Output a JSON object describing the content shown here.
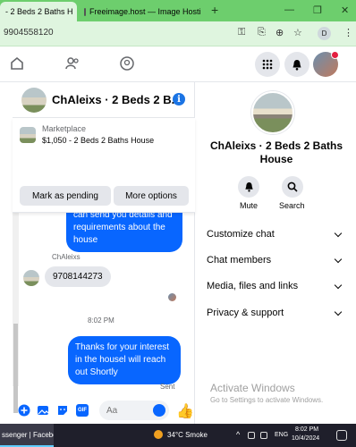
{
  "browser": {
    "tabs": [
      {
        "title": "- 2 Beds 2 Baths H",
        "active": true
      },
      {
        "title": "Freeimage.host — Image Hosti",
        "active": false
      }
    ],
    "new_tab": "+",
    "url": "9904558120",
    "profile_initial": "D"
  },
  "chat": {
    "title": "ChAleixs · 2 Beds 2 B...",
    "marketplace": {
      "label": "Marketplace",
      "listing": "$1,050 - 2 Beds 2 Baths House",
      "mark_pending": "Mark as pending",
      "more_options": "More options"
    },
    "messages": {
      "outgoing_1": "Yes the house is still available for rent,let me your contact number so i can send you details and requirements about the house",
      "sender_name": "ChAleixs",
      "incoming_1": "9708144273",
      "timestamp": "8:02 PM",
      "outgoing_2": "Thanks for your interest in the housel will reach out Shortly",
      "sent_status": "Sent"
    },
    "composer": {
      "placeholder": "Aa"
    }
  },
  "info_panel": {
    "name": "ChAleixs · 2 Beds 2 Baths House",
    "actions": {
      "mute": "Mute",
      "search": "Search"
    },
    "sections": [
      "Customize chat",
      "Chat members",
      "Media, files and links",
      "Privacy & support"
    ],
    "watermark": {
      "title": "Activate Windows",
      "subtitle": "Go to Settings to activate Windows."
    }
  },
  "taskbar": {
    "app_label": "ssenger | Faceboo",
    "weather": "34°C  Smoke",
    "language": "ENG",
    "time": "8:02 PM",
    "date": "10/4/2024"
  },
  "colors": {
    "tabbar": "#6dce6d",
    "messenger_blue": "#0866ff",
    "info_blue": "#1b74e4",
    "bubble_gray": "#e4e6eb"
  }
}
